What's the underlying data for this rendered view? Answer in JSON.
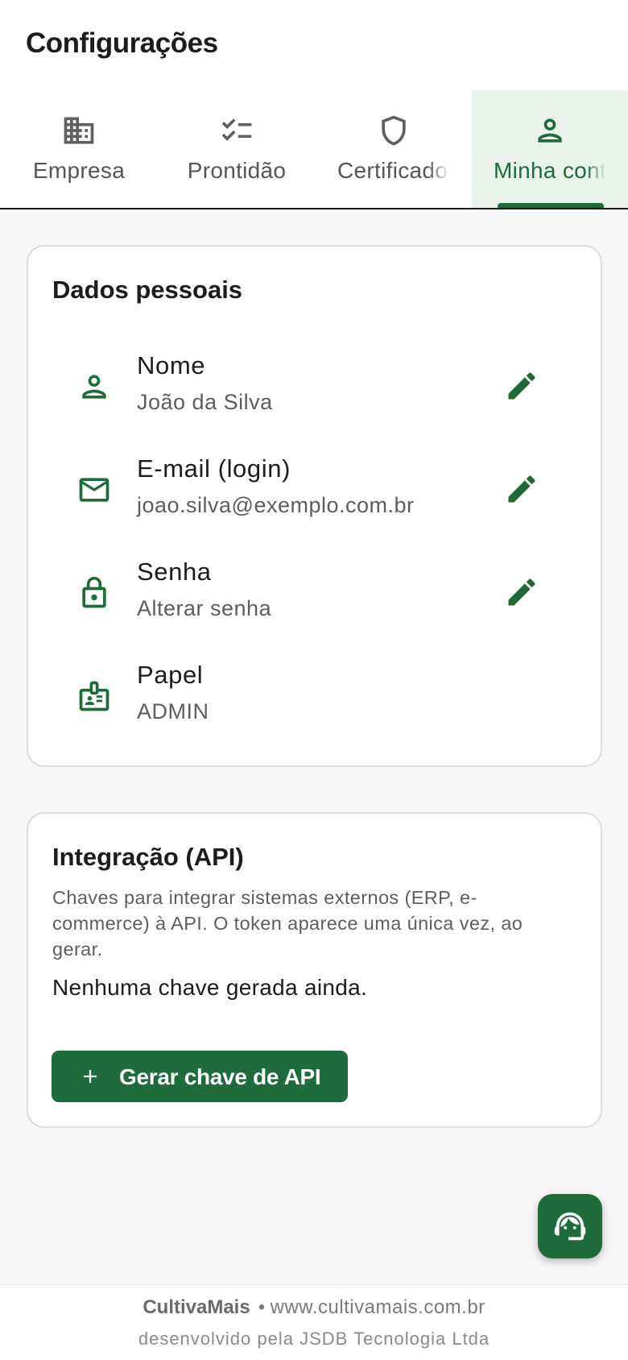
{
  "header": {
    "title": "Configurações"
  },
  "tabs": [
    {
      "label": "Empresa",
      "icon": "building-icon",
      "active": false
    },
    {
      "label": "Prontidão",
      "icon": "checklist-icon",
      "active": false
    },
    {
      "label": "Certificado",
      "icon": "shield-icon",
      "active": false
    },
    {
      "label": "Minha conta",
      "icon": "person-icon",
      "active": true
    }
  ],
  "personal": {
    "title": "Dados pessoais",
    "fields": [
      {
        "label": "Nome",
        "value": "João da Silva",
        "icon": "person-icon",
        "editable": true
      },
      {
        "label": "E-mail (login)",
        "value": "joao.silva@exemplo.com.br",
        "icon": "mail-icon",
        "editable": true
      },
      {
        "label": "Senha",
        "value": "Alterar senha",
        "icon": "lock-icon",
        "editable": true
      },
      {
        "label": "Papel",
        "value": "ADMIN",
        "icon": "badge-icon",
        "editable": false
      }
    ]
  },
  "api": {
    "title": "Integração (API)",
    "description": "Chaves para integrar sistemas externos (ERP, e-commerce) à API. O token aparece uma única vez, ao gerar.",
    "empty_text": "Nenhuma chave gerada ainda.",
    "button_label": "Gerar chave de API"
  },
  "fab": {
    "icon": "support-agent-icon"
  },
  "footer": {
    "brand": "CultivaMais",
    "separator": "•",
    "url": "www.cultivamais.com.br",
    "credit": "desenvolvido pela JSDB Tecnologia Ltda"
  },
  "colors": {
    "accent": "#1f6b39",
    "active_tab_bg": "#e9f3eb"
  }
}
